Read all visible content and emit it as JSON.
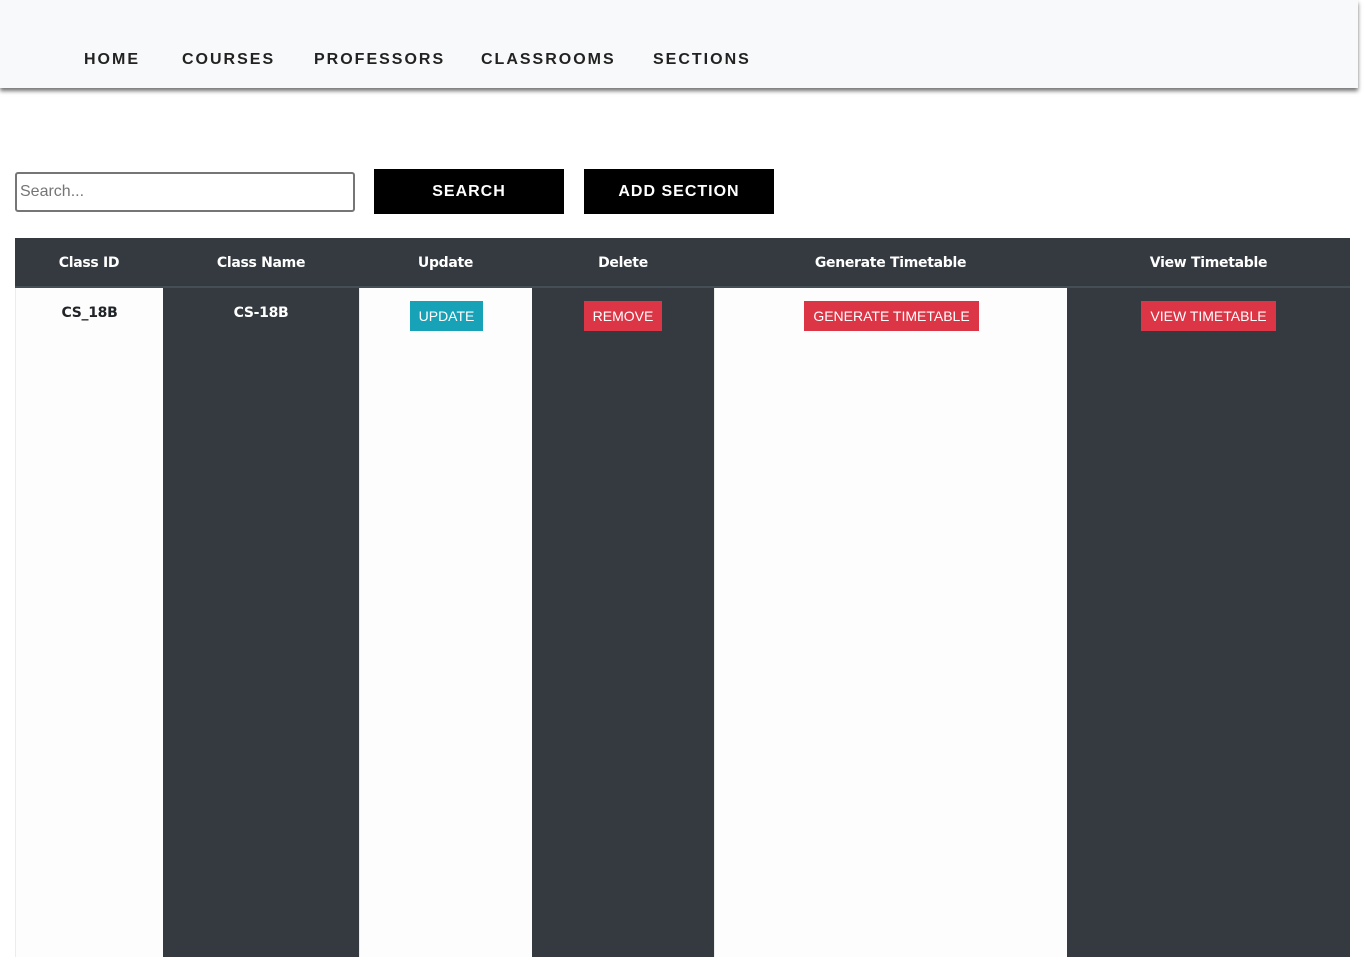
{
  "nav": {
    "items": [
      {
        "label": "HOME"
      },
      {
        "label": "COURSES"
      },
      {
        "label": "PROFESSORS"
      },
      {
        "label": "CLASSROOMS"
      },
      {
        "label": "SECTIONS"
      }
    ]
  },
  "search": {
    "placeholder": "Search...",
    "value": "",
    "button_label": "SEARCH"
  },
  "actions": {
    "add_label": "ADD SECTION"
  },
  "table": {
    "headers": [
      "Class ID",
      "Class Name",
      "Update",
      "Delete",
      "Generate Timetable",
      "View Timetable"
    ],
    "rows": [
      {
        "class_id": "CS_18B",
        "class_name": "CS-18B",
        "update_label": "UPDATE",
        "delete_label": "REMOVE",
        "generate_label": "GENERATE TIMETABLE",
        "view_label": "VIEW TIMETABLE"
      }
    ]
  },
  "colors": {
    "navbar_bg": "#f8f9fa",
    "table_dark": "#343a40",
    "info": "#17a2b8",
    "danger": "#dc3545",
    "black_button": "#000000"
  }
}
